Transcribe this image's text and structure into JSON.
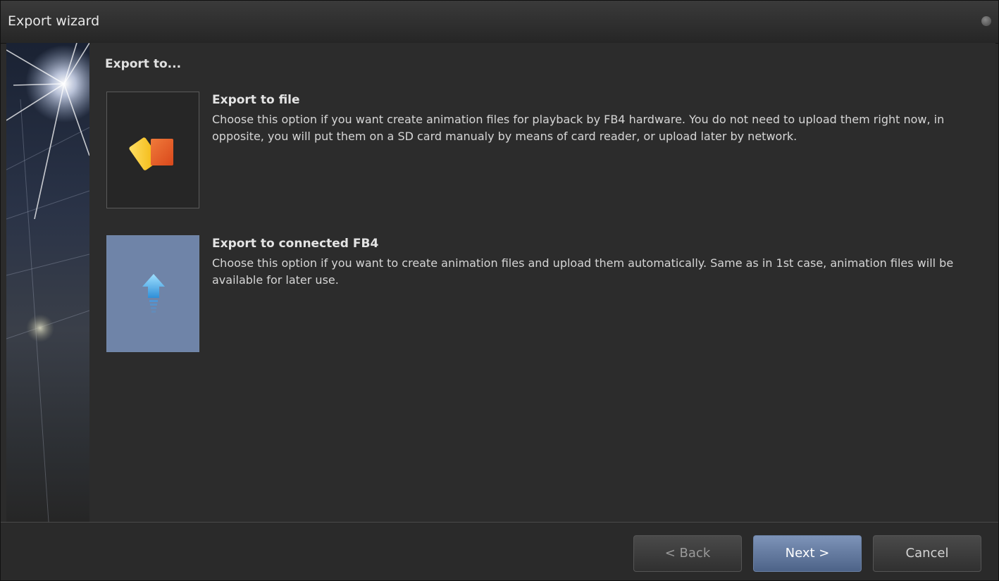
{
  "window": {
    "title": "Export wizard"
  },
  "content": {
    "heading": "Export to...",
    "options": [
      {
        "title": "Export to file",
        "description": "Choose this option if you want create animation files for playback by FB4 hardware. You do not need to upload them right now, in opposite, you will put them on a SD card manualy by means of card reader, or upload later by network.",
        "icon": "file-cards-icon",
        "selected": false
      },
      {
        "title": "Export to connected FB4",
        "description": "Choose this option if you want to create animation files and upload them automatically. Same as in 1st case, animation files will be available for later use.",
        "icon": "upload-arrow-icon",
        "selected": true
      }
    ]
  },
  "footer": {
    "back_label": "< Back",
    "next_label": "Next >",
    "cancel_label": "Cancel"
  },
  "colors": {
    "window_bg": "#2c2c2c",
    "selected_option_bg": "#6f84a8",
    "primary_button": "#5d739a"
  }
}
